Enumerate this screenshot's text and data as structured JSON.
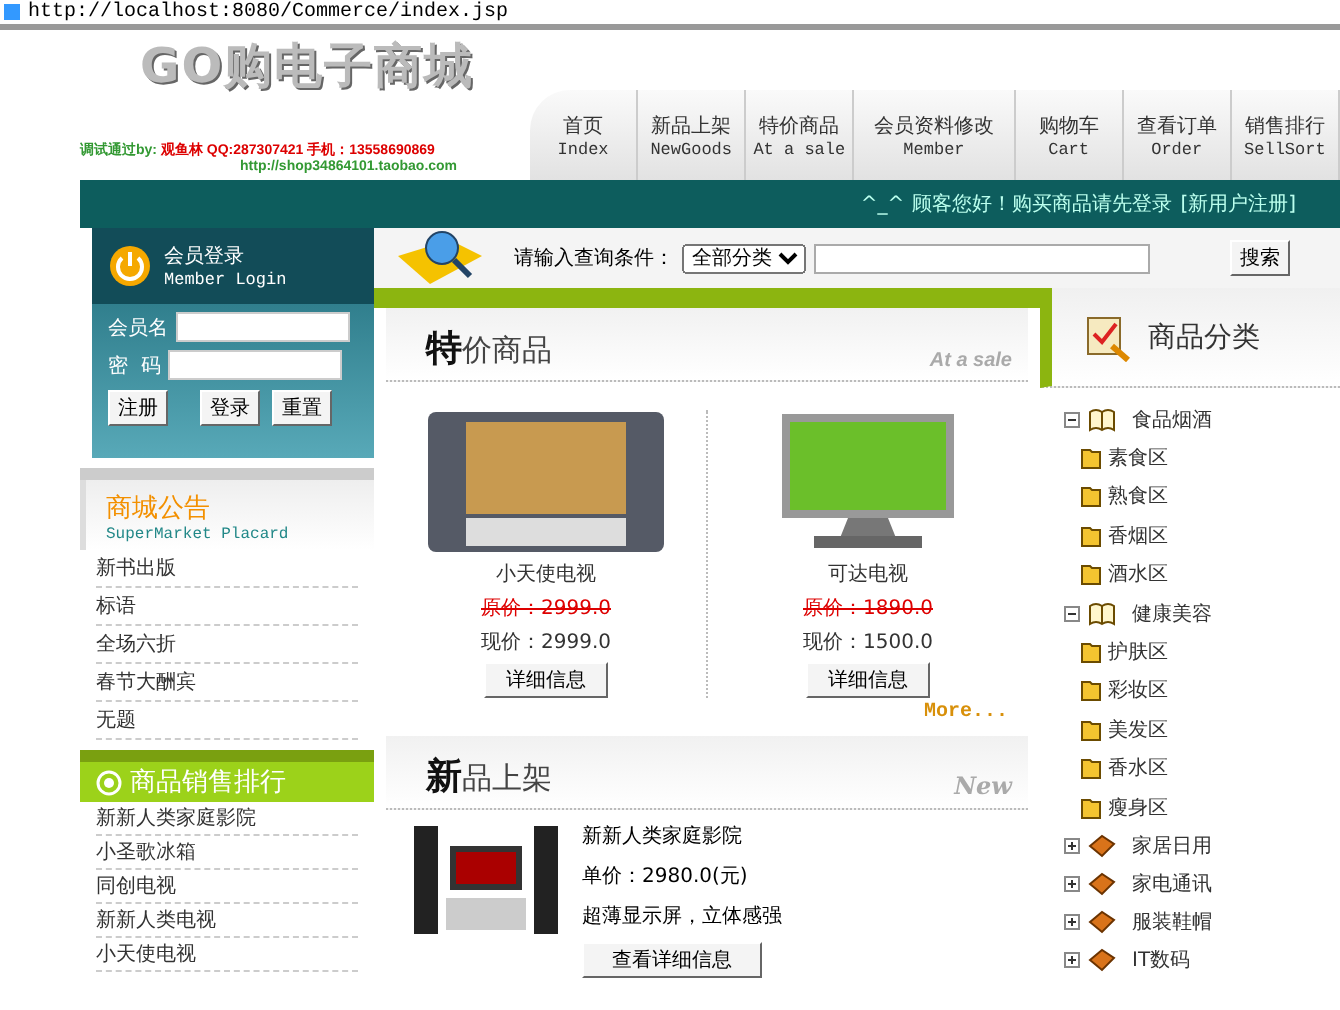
{
  "address_bar": {
    "url": "http://localhost:8080/Commerce/index.jsp"
  },
  "header": {
    "logo": "GO购电子商城",
    "credit_label": "调试通过by:",
    "credit_name": "观鱼林",
    "contact": "QQ:287307421 手机：13558690869",
    "shop_url": "http://shop34864101.taobao.com",
    "nav": [
      {
        "label": "首页",
        "sub": "Index"
      },
      {
        "label": "新品上架",
        "sub": "NewGoods"
      },
      {
        "label": "特价商品",
        "sub": "At a sale"
      },
      {
        "label": "会员资料修改",
        "sub": "Member"
      },
      {
        "label": "购物车",
        "sub": "Cart"
      },
      {
        "label": "查看订单",
        "sub": "Order"
      },
      {
        "label": "销售排行",
        "sub": "SellSort"
      }
    ]
  },
  "welcome_bar": {
    "mark": "^_^",
    "text": "顾客您好！购买商品请先登录",
    "link": "[新用户注册]"
  },
  "login": {
    "title": "会员登录",
    "subtitle": "Member Login",
    "username_label": "会员名",
    "password_label": "密  码",
    "buttons": [
      "注册",
      "登录",
      "重置"
    ]
  },
  "placard": {
    "title": "商城公告",
    "subtitle": "SuperMarket Placard",
    "items": [
      "新书出版",
      "标语",
      "全场六折",
      "春节大酬宾",
      "无题"
    ]
  },
  "sales_ranking": {
    "title": "商品销售排行",
    "items": [
      "新新人类家庭影院",
      "小圣歌冰箱",
      "同创电视",
      "新新人类电视",
      "小天使电视"
    ]
  },
  "search": {
    "label": "请输入查询条件：",
    "category": "全部分类",
    "button": "搜索"
  },
  "sale": {
    "title_first": "特",
    "title_rest": "价商品",
    "tag": "At a sale",
    "more": "More...",
    "products": [
      {
        "name": "小天使电视",
        "original_price": "原价：2999.0",
        "price": "现价：2999.0",
        "button": "详细信息",
        "kind": "crt"
      },
      {
        "name": "可达电视",
        "original_price": "原价：1890.0",
        "price": "现价：1500.0",
        "button": "详细信息",
        "kind": "lcd"
      }
    ]
  },
  "new_goods": {
    "title_first": "新",
    "title_rest": "品上架",
    "tag": "New",
    "item": {
      "name": "新新人类家庭影院",
      "price": "单价：2980.0(元)",
      "desc": "超薄显示屏，立体感强",
      "button": "查看详细信息"
    }
  },
  "categories": {
    "title": "商品分类",
    "tree": [
      {
        "label": "食品烟酒",
        "expanded": true,
        "children": [
          "素食区",
          "熟食区",
          "香烟区",
          "酒水区"
        ]
      },
      {
        "label": "健康美容",
        "expanded": true,
        "children": [
          "护肤区",
          "彩妆区",
          "美发区",
          "香水区",
          "瘦身区"
        ]
      },
      {
        "label": "家居日用",
        "expanded": false
      },
      {
        "label": "家电通讯",
        "expanded": false
      },
      {
        "label": "服装鞋帽",
        "expanded": false
      },
      {
        "label": "IT数码",
        "expanded": false
      }
    ]
  }
}
